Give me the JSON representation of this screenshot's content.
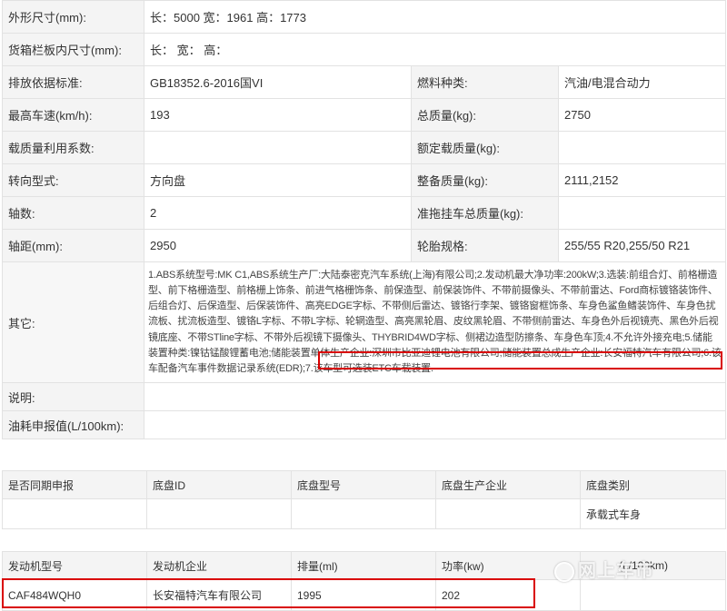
{
  "spec": {
    "rows": [
      {
        "l1": "外形尺寸(mm):",
        "v1": "长：5000 宽：1961 高：1773",
        "l2": "",
        "v2": ""
      },
      {
        "l1": "货箱栏板内尺寸(mm):",
        "v1": "长：  宽：  高：",
        "l2": "",
        "v2": ""
      },
      {
        "l1": "排放依据标准:",
        "v1": "GB18352.6-2016国VI",
        "l2": "燃料种类:",
        "v2": "汽油/电混合动力"
      },
      {
        "l1": "最高车速(km/h):",
        "v1": "193",
        "l2": "总质量(kg):",
        "v2": "2750"
      },
      {
        "l1": "载质量利用系数:",
        "v1": "",
        "l2": "额定载质量(kg):",
        "v2": ""
      },
      {
        "l1": "转向型式:",
        "v1": "方向盘",
        "l2": "整备质量(kg):",
        "v2": "2111,2152"
      },
      {
        "l1": "轴数:",
        "v1": "2",
        "l2": "准拖挂车总质量(kg):",
        "v2": ""
      },
      {
        "l1": "轴距(mm):",
        "v1": "2950",
        "l2": "轮胎规格:",
        "v2": "255/55 R20,255/50 R21"
      }
    ],
    "other_label": "其它:",
    "other_text": "1.ABS系统型号:MK C1,ABS系统生产厂:大陆泰密克汽车系统(上海)有限公司;2.发动机最大净功率:200kW;3.选装:前组合灯、前格栅造型、前下格栅造型、前格栅上饰条、前进气格栅饰条、前保造型、前保装饰件、不带前摄像头、不带前雷达、Ford商标镀铬装饰件、后组合灯、后保造型、后保装饰件、高亮EDGE字标、不带侧后雷达、镀铬行李架、镀铬窗框饰条、车身色鲨鱼鳍装饰件、车身色扰流板、扰流板造型、镀铬L字标、不带L字标、轮辋造型、高亮黑轮眉、皮纹黑轮眉、不带侧前雷达、车身色外后视镜壳、黑色外后视镜底座、不带STline字标、不带外后视镜下摄像头、THYBRID4WD字标、侧裙边造型防擦条、车身色车顶;4.不允许外接充电;",
    "other_text_hl": "5.储能装置种类:镍钴锰酸锂蓄电池;储能装置单体生产企业:深圳市比亚迪锂电池有限公司",
    "other_text_rest": ";储能装置总成生产企业:长安福特汽车有限公司;6.该车配备汽车事件数据记录系统(EDR);7.该车型可选装ETC车载装置.",
    "note_label": "说明:",
    "note_value": "",
    "fuel_label": "油耗申报值(L/100km):",
    "fuel_value": ""
  },
  "chassis": {
    "headers": [
      "是否同期申报",
      "底盘ID",
      "底盘型号",
      "底盘生产企业",
      "底盘类别"
    ],
    "values": [
      "",
      "",
      "",
      "",
      "承载式车身"
    ]
  },
  "engine": {
    "headers": [
      "发动机型号",
      "发动机企业",
      "排量(ml)",
      "功率(kw)",
      "(L/100km)"
    ],
    "values": [
      "CAF484WQH0",
      "长安福特汽车有限公司",
      "1995",
      "202",
      ""
    ]
  },
  "watermark": "网上车市",
  "colors": {
    "highlight_box": "#d90000",
    "label_bg": "#f4f4f4",
    "border": "#e2e2e2"
  }
}
